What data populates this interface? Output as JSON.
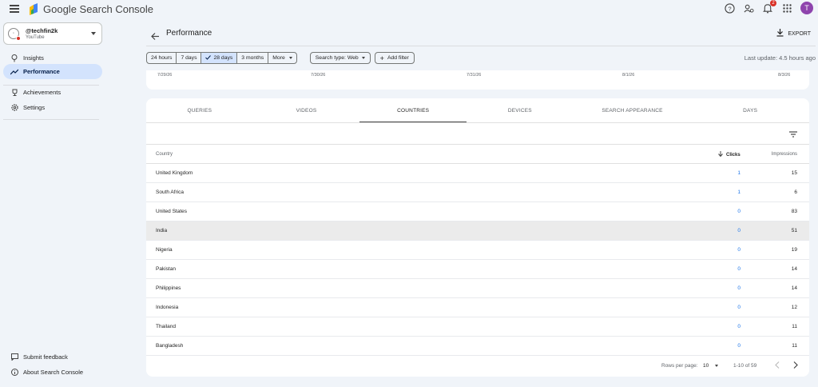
{
  "app": {
    "title": "Google Search Console"
  },
  "topbar": {
    "notification_count": "2",
    "avatar_letter": "T"
  },
  "property": {
    "name": "@techfin2k",
    "type": "YouTube"
  },
  "sidebar": {
    "items": [
      {
        "label": "Insights"
      },
      {
        "label": "Performance"
      },
      {
        "label": "Achievements"
      },
      {
        "label": "Settings"
      }
    ],
    "footer": [
      {
        "label": "Submit feedback"
      },
      {
        "label": "About Search Console"
      }
    ]
  },
  "header": {
    "title": "Performance",
    "export_label": "EXPORT"
  },
  "filters": {
    "ranges": [
      "24 hours",
      "7 days",
      "28 days",
      "3 months",
      "More"
    ],
    "selected_range": "28 days",
    "search_type": "Search type: Web",
    "add_filter": "Add filter",
    "last_update": "Last update: 4.5 hours ago"
  },
  "chart_dates": [
    "7/29/26",
    "7/30/26",
    "7/31/26",
    "8/1/26",
    "8/3/26"
  ],
  "tabs": [
    "QUERIES",
    "VIDEOS",
    "COUNTRIES",
    "DEVICES",
    "SEARCH APPEARANCE",
    "DAYS"
  ],
  "active_tab": "COUNTRIES",
  "table": {
    "headers": {
      "country": "Country",
      "clicks": "Clicks",
      "impressions": "Impressions"
    },
    "rows": [
      {
        "country": "United Kingdom",
        "clicks": "1",
        "impressions": "15"
      },
      {
        "country": "South Africa",
        "clicks": "1",
        "impressions": "6"
      },
      {
        "country": "United States",
        "clicks": "0",
        "impressions": "83"
      },
      {
        "country": "India",
        "clicks": "0",
        "impressions": "51"
      },
      {
        "country": "Nigeria",
        "clicks": "0",
        "impressions": "19"
      },
      {
        "country": "Pakistan",
        "clicks": "0",
        "impressions": "14"
      },
      {
        "country": "Philippines",
        "clicks": "0",
        "impressions": "14"
      },
      {
        "country": "Indonesia",
        "clicks": "0",
        "impressions": "12"
      },
      {
        "country": "Thailand",
        "clicks": "0",
        "impressions": "11"
      },
      {
        "country": "Bangladesh",
        "clicks": "0",
        "impressions": "11"
      }
    ]
  },
  "pagination": {
    "rows_per_page_label": "Rows per page:",
    "rows_per_page": "10",
    "range": "1-10 of 59"
  },
  "colors": {
    "accent": "#1a73e8",
    "selected_bg": "#d3e3fd",
    "avatar": "#8e44ad"
  }
}
